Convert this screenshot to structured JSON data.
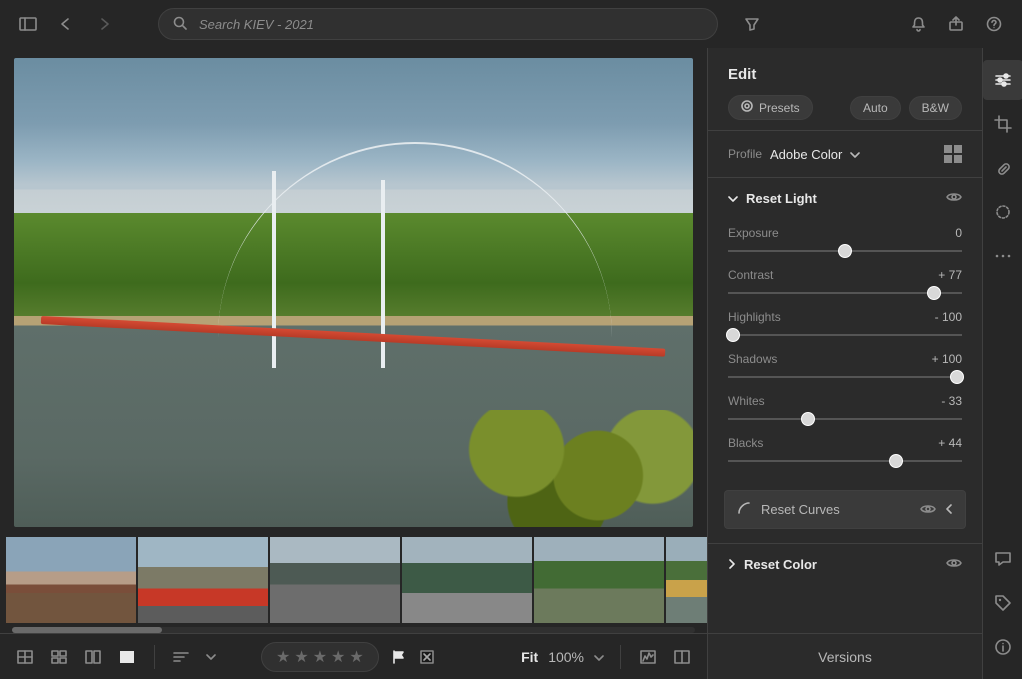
{
  "search": {
    "placeholder": "Search KIEV - 2021"
  },
  "panel": {
    "title": "Edit",
    "presets_label": "Presets",
    "auto_label": "Auto",
    "bw_label": "B&W",
    "profile_label": "Profile",
    "profile_value": "Adobe Color",
    "light_section": "Reset Light",
    "curves_label": "Reset Curves",
    "color_section": "Reset Color",
    "versions_label": "Versions",
    "sliders": {
      "exposure": {
        "label": "Exposure",
        "value": "0",
        "pct": 50
      },
      "contrast": {
        "label": "Contrast",
        "value": "+ 77",
        "pct": 88
      },
      "highlights": {
        "label": "Highlights",
        "value": "- 100",
        "pct": 2
      },
      "shadows": {
        "label": "Shadows",
        "value": "+ 100",
        "pct": 98
      },
      "whites": {
        "label": "Whites",
        "value": "- 33",
        "pct": 34
      },
      "blacks": {
        "label": "Blacks",
        "value": "+ 44",
        "pct": 72
      }
    }
  },
  "zoom": {
    "fit": "Fit",
    "pct": "100%"
  }
}
